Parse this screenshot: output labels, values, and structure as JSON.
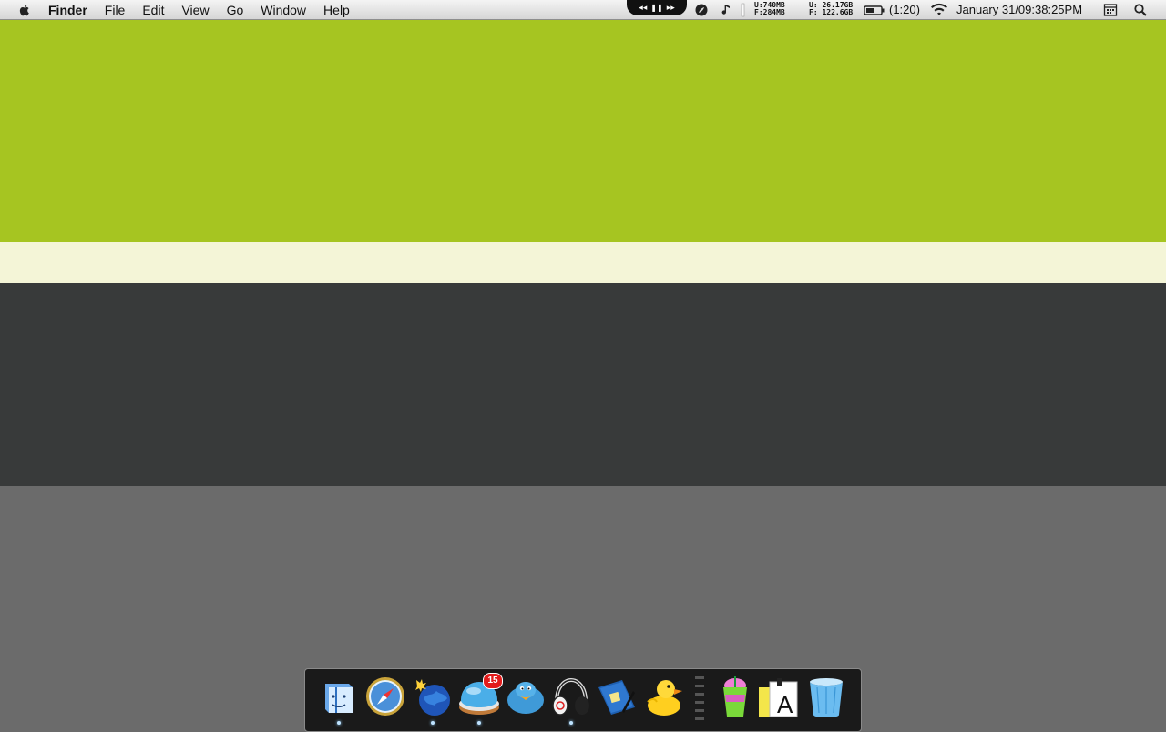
{
  "menubar": {
    "app_name": "Finder",
    "menus": [
      "File",
      "Edit",
      "View",
      "Go",
      "Window",
      "Help"
    ],
    "media_controls": {
      "prev": "◂◂",
      "pause": "❚❚",
      "next": "▸▸"
    },
    "memory": {
      "u_label": "U:",
      "u_value": "740MB",
      "f_label": "F:",
      "f_value": "284MB"
    },
    "disk": {
      "u_label": "U:",
      "u_value": "26.17GB",
      "f_label": "F:",
      "f_value": "122.6GB"
    },
    "battery_time": "(1:20)",
    "clock": "January 31/09:38:25PM"
  },
  "desktop": {
    "colors": {
      "green": "#a6c521",
      "cream": "#f4f5d7",
      "dark": "#383a3a",
      "gray": "#6b6b6b"
    }
  },
  "dock": {
    "items": [
      {
        "name": "Finder",
        "icon": "finder-icon",
        "running": true
      },
      {
        "name": "Safari",
        "icon": "safari-icon",
        "running": false
      },
      {
        "name": "Camino",
        "icon": "globe-bomb-icon",
        "running": true
      },
      {
        "name": "Mail",
        "icon": "mail-bubble-icon",
        "running": true,
        "badge": "15"
      },
      {
        "name": "Twitter",
        "icon": "bird-icon",
        "running": false
      },
      {
        "name": "Headphones",
        "icon": "headphones-icon",
        "running": true
      },
      {
        "name": "Notes",
        "icon": "notebook-icon",
        "running": false
      },
      {
        "name": "Cyberduck",
        "icon": "duck-icon",
        "running": false
      },
      {
        "name": "Slurpee",
        "icon": "slushie-cup-icon",
        "running": false
      },
      {
        "name": "Font Book",
        "icon": "font-book-icon",
        "running": false
      },
      {
        "name": "Trash",
        "icon": "trash-icon",
        "running": false
      }
    ]
  }
}
